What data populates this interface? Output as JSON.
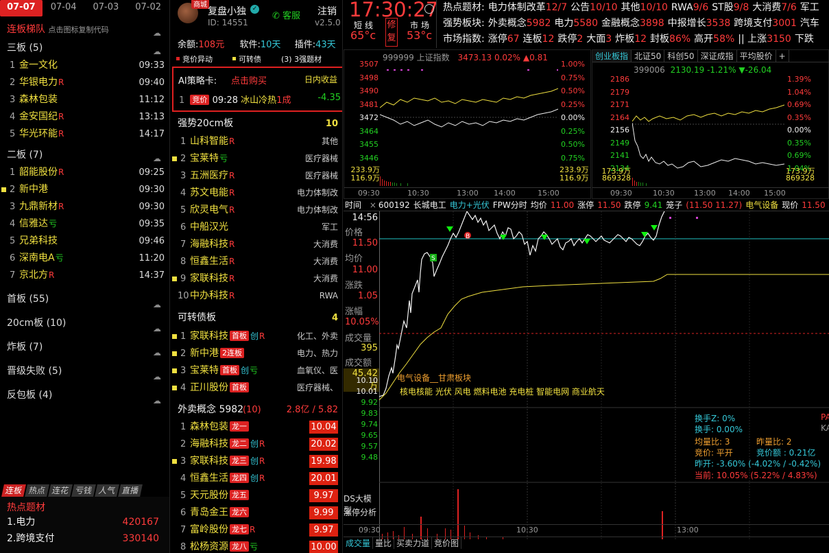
{
  "left": {
    "date_tabs": [
      "07-07",
      "07-04",
      "07-03",
      "07-02"
    ],
    "title": "连板梯队",
    "subtitle": "点击图标复制代码",
    "groups": [
      {
        "label": "三板 (5)",
        "items": [
          {
            "n": "1",
            "name": "金一文化",
            "flag": "",
            "time": "09:33",
            "mark": false
          },
          {
            "n": "2",
            "name": "华银电力",
            "flag": "R",
            "time": "09:40",
            "mark": false
          },
          {
            "n": "3",
            "name": "森林包装",
            "flag": "",
            "time": "11:12",
            "mark": false
          },
          {
            "n": "4",
            "name": "金安国纪",
            "flag": "R",
            "time": "13:13",
            "mark": false
          },
          {
            "n": "5",
            "name": "华光环能",
            "flag": "R",
            "time": "14:17",
            "mark": false
          }
        ]
      },
      {
        "label": "二板 (7)",
        "items": [
          {
            "n": "1",
            "name": "韶能股份",
            "flag": "R",
            "time": "09:25",
            "mark": false
          },
          {
            "n": "2",
            "name": "新中港",
            "flag": "",
            "time": "09:30",
            "mark": true
          },
          {
            "n": "3",
            "name": "九鼎新材",
            "flag": "R",
            "time": "09:30",
            "mark": false
          },
          {
            "n": "4",
            "name": "信雅达",
            "flag": "亏",
            "time": "09:35",
            "mark": false
          },
          {
            "n": "5",
            "name": "兄弟科技",
            "flag": "",
            "time": "09:46",
            "mark": false
          },
          {
            "n": "6",
            "name": "深南电A",
            "flag": "亏",
            "time": "11:20",
            "mark": false
          },
          {
            "n": "7",
            "name": "京北方",
            "flag": "R",
            "time": "14:37",
            "mark": false
          }
        ]
      }
    ],
    "collapsed": [
      "首板 (55)",
      "20cm板 (10)",
      "炸板 (7)",
      "晋级失败 (5)",
      "反包板 (4)"
    ],
    "bottom_tabs": [
      "连板",
      "热点",
      "连花",
      "亏钱",
      "人气",
      "直播"
    ],
    "hot_title": "热点题材",
    "hot_items": [
      {
        "name": "1.电力",
        "value": "420167"
      },
      {
        "name": "2.跨境支付",
        "value": "330140"
      }
    ]
  },
  "profile": {
    "badge": "商城",
    "name": "复盘小独",
    "id": "ID: 14551",
    "service": "客服",
    "logout": "注销",
    "version": "v2.5.0",
    "balance_label": "余额:",
    "balance": "108元",
    "software_label": "软件:",
    "software": "10天",
    "plugin_label": "插件:",
    "plugin": "43天",
    "legend": [
      "竞价异动",
      "可转债",
      "(3) 3强题材"
    ]
  },
  "ai_card": {
    "title": "AI策略卡:",
    "buy": "点击购买",
    "right": "日内收益",
    "row": {
      "n": "1",
      "tag": "竞价",
      "time": "09:28",
      "name": "冰山冷热",
      "board": "1成",
      "value": "-4.35"
    }
  },
  "strong": {
    "title": "强势20cm板",
    "count": "10",
    "items": [
      {
        "n": "1",
        "name": "山科智能",
        "flag": "R",
        "tag": "其他",
        "mark": false
      },
      {
        "n": "2",
        "name": "宝莱特",
        "flag": "亏",
        "tag": "医疗器械",
        "mark": true
      },
      {
        "n": "3",
        "name": "五洲医疗",
        "flag": "R",
        "tag": "医疗器械",
        "mark": false
      },
      {
        "n": "4",
        "name": "苏文电能",
        "flag": "R",
        "tag": "电力体制改",
        "mark": false
      },
      {
        "n": "5",
        "name": "欣灵电气",
        "flag": "R",
        "tag": "电力体制改",
        "mark": false
      },
      {
        "n": "6",
        "name": "中船汉光",
        "flag": "",
        "tag": "军工",
        "mark": false
      },
      {
        "n": "7",
        "name": "海融科技",
        "flag": "R",
        "tag": "大消费",
        "mark": false
      },
      {
        "n": "8",
        "name": "恒鑫生活",
        "flag": "R",
        "tag": "大消费",
        "mark": false
      },
      {
        "n": "9",
        "name": "家联科技",
        "flag": "R",
        "tag": "大消费",
        "mark": true
      },
      {
        "n": "10",
        "name": "中办科技",
        "flag": "R",
        "tag": "RWA",
        "mark": false
      }
    ]
  },
  "bonds": {
    "title": "可转债板",
    "count": "4",
    "items": [
      {
        "n": "1",
        "name": "家联科技",
        "badge": "首板",
        "f1": "创",
        "f2": "R",
        "tag": "化工、外卖",
        "mark": true
      },
      {
        "n": "2",
        "name": "新中港",
        "badge": "2连板",
        "f1": "",
        "f2": "",
        "tag": "电力、热力",
        "mark": true
      },
      {
        "n": "3",
        "name": "宝莱特",
        "badge": "首板",
        "f1": "创",
        "f2": "亏",
        "tag": "血氧仪、医",
        "mark": true
      },
      {
        "n": "4",
        "name": "正川股份",
        "badge": "首板",
        "f1": "",
        "f2": "",
        "tag": "医疗器械、",
        "mark": true
      }
    ]
  },
  "takeout": {
    "title": "外卖概念",
    "count": "5982",
    "sub": "(10)",
    "amount": "2.8亿 / 5.82",
    "items": [
      {
        "n": "1",
        "name": "森林包装",
        "badge": "龙一",
        "f1": "",
        "f2": "",
        "value": "10.04",
        "mark": false
      },
      {
        "n": "2",
        "name": "海融科技",
        "badge": "龙二",
        "f1": "创",
        "f2": "R",
        "value": "20.02",
        "mark": false
      },
      {
        "n": "3",
        "name": "家联科技",
        "badge": "龙三",
        "f1": "创",
        "f2": "R",
        "value": "19.98",
        "mark": true
      },
      {
        "n": "4",
        "name": "恒鑫生活",
        "badge": "龙四",
        "f1": "创",
        "f2": "R",
        "value": "20.01",
        "mark": false
      },
      {
        "n": "5",
        "name": "天元股份",
        "badge": "龙五",
        "f1": "",
        "f2": "",
        "value": "9.97",
        "mark": false
      },
      {
        "n": "6",
        "name": "青岛金王",
        "badge": "龙六",
        "f1": "",
        "f2": "",
        "value": "9.99",
        "mark": false
      },
      {
        "n": "7",
        "name": "富岭股份",
        "badge": "龙七",
        "f1": "",
        "f2": "R",
        "value": "9.97",
        "mark": false
      },
      {
        "n": "8",
        "name": "松杨资源",
        "badge": "龙八",
        "f1": "",
        "f2": "亏",
        "value": "10.00",
        "mark": false
      }
    ]
  },
  "header": {
    "clock": "17:30:27",
    "short_label": "短线",
    "short_temp": "65°c",
    "fix": [
      "修",
      "复"
    ],
    "market_label": "市场",
    "market_temp": "53°c",
    "rows": [
      {
        "label": "热点题材:",
        "items": [
          [
            "电力体制改革",
            "12/7"
          ],
          [
            "公告",
            "10/10"
          ],
          [
            "其他",
            "10/10"
          ],
          [
            "RWA",
            "9/6"
          ],
          [
            "ST股",
            "9/8"
          ],
          [
            "大消费",
            "7/6"
          ],
          [
            "军工",
            ""
          ]
        ]
      },
      {
        "label": "强势板块:",
        "items": [
          [
            "外卖概念",
            "5982"
          ],
          [
            "电力",
            "5580"
          ],
          [
            "金融概念",
            "3898"
          ],
          [
            "中报增长",
            "3538"
          ],
          [
            "跨境支付",
            "3001"
          ],
          [
            "汽车",
            ""
          ]
        ]
      },
      {
        "label": "市场指数:",
        "items": [
          [
            "涨停",
            "67"
          ],
          [
            "连板",
            "12"
          ],
          [
            "跌停",
            "2"
          ],
          [
            "大面",
            "3"
          ],
          [
            "炸板",
            "12"
          ],
          [
            "封板",
            "86%"
          ],
          [
            "高开",
            "58%"
          ],
          [
            "|| 上涨",
            "3150"
          ],
          [
            "下跌",
            ""
          ]
        ]
      }
    ]
  },
  "index_chart": {
    "code": "999999",
    "name": "上证指数",
    "price": "3473.13",
    "pct": "0.02%",
    "chg": "▲0.81",
    "left_ticks": [
      "3507",
      "3498",
      "3490",
      "3481",
      "3472",
      "3464",
      "3455",
      "3446"
    ],
    "right_ticks": [
      "1.00%",
      "0.75%",
      "0.50%",
      "0.25%",
      "0.00%",
      "0.25%",
      "0.50%",
      "0.75%"
    ],
    "vol_left": [
      "233.9万",
      "116.9万"
    ],
    "vol_right": [
      "233.9万",
      "116.9万"
    ],
    "times": [
      "09:30",
      "10:30",
      "13:00",
      "14:00",
      "15:00"
    ]
  },
  "gem_chart": {
    "tabs": [
      "创业板指",
      "北证50",
      "科创50",
      "深证成指",
      "平均股价",
      "+"
    ],
    "code": "399006",
    "price": "2130.19",
    "pct": "-1.21%",
    "chg": "▼-26.04",
    "left_ticks": [
      "2186",
      "2179",
      "2171",
      "2164",
      "2156",
      "2149",
      "2141",
      "2134"
    ],
    "right_ticks": [
      "1.39%",
      "1.04%",
      "0.69%",
      "0.35%",
      "0.00%",
      "0.35%",
      "0.69%",
      "1.04%"
    ],
    "vol_left": [
      "173.9万",
      "869328"
    ],
    "vol_right": [
      "173.9万",
      "869328"
    ],
    "times": [
      "09:30",
      "10:30",
      "13:00",
      "14:00",
      "15:00"
    ]
  },
  "stock_chart": {
    "bar": {
      "time_label": "时间",
      "code": "600192",
      "name": "长城电工",
      "concept": "电力+光伏",
      "mode": "FPW分时",
      "avg_label": "均价",
      "avg": "11.00",
      "up_label": "涨停",
      "up": "11.50",
      "down_label": "跌停",
      "down": "9.41",
      "cage_label": "笼子",
      "cage": "(11.50 11.27)",
      "sector": "电气设备",
      "now_label": "现价",
      "now": "11.50",
      "now_pct": "10.05%"
    },
    "side_labels": [
      {
        "k": "time",
        "v": "14:56",
        "cls": "wht"
      },
      {
        "k": "price_label",
        "v": "价格",
        "cls": "gry"
      },
      {
        "k": "price",
        "v": "11.50",
        "cls": "red"
      },
      {
        "k": "avg_label",
        "v": "均价",
        "cls": "gry"
      },
      {
        "k": "avg",
        "v": "11.00",
        "cls": "red"
      },
      {
        "k": "chg_label",
        "v": "涨跌",
        "cls": "gry"
      },
      {
        "k": "chg",
        "v": "1.05",
        "cls": "red"
      },
      {
        "k": "amp_label",
        "v": "涨幅",
        "cls": "gry"
      },
      {
        "k": "amp",
        "v": "10.05%",
        "cls": "red"
      },
      {
        "k": "vol_label",
        "v": "成交量",
        "cls": "gry"
      },
      {
        "k": "vol",
        "v": "395",
        "cls": "yel"
      },
      {
        "k": "amt_label",
        "v": "成交额",
        "cls": "gry"
      },
      {
        "k": "amt",
        "v": "45.42万",
        "cls": "yel"
      }
    ],
    "low_ticks": [
      "10.10",
      "10.01",
      "9.92",
      "9.83",
      "9.74",
      "9.65",
      "9.57",
      "9.48"
    ],
    "sector_line": "电气设备__甘肃板块",
    "concepts": "核电核能 光伏 风电 燃料电池 充电桩 智能电网 商业航天",
    "stats": {
      "turn_z": "换手Z: 0%",
      "turn": "换手:   0.00%",
      "vr": "均量比: 3",
      "vr_y": "昨量比: 2",
      "bid": "竞价: 平开",
      "bid_amt": "竞价额 : 0.21亿",
      "open": "昨开: -3.60%  (-4.02% / -0.42%)",
      "now": "当前: 10.05%  (5.22% / 4.83%)",
      "edge1": "PA",
      "edge2": "KA"
    },
    "vol_labels": [
      "DS大模型",
      "涨停分析"
    ],
    "times": [
      "09:30",
      "10:30",
      "13:00"
    ],
    "bottom_tabs": [
      "成交量",
      "量比",
      "买卖力道",
      "竞价图"
    ]
  },
  "colors": {
    "up": "#ff3b3b",
    "down": "#22d022",
    "name": "#f0e040",
    "accent": "#d22222"
  }
}
